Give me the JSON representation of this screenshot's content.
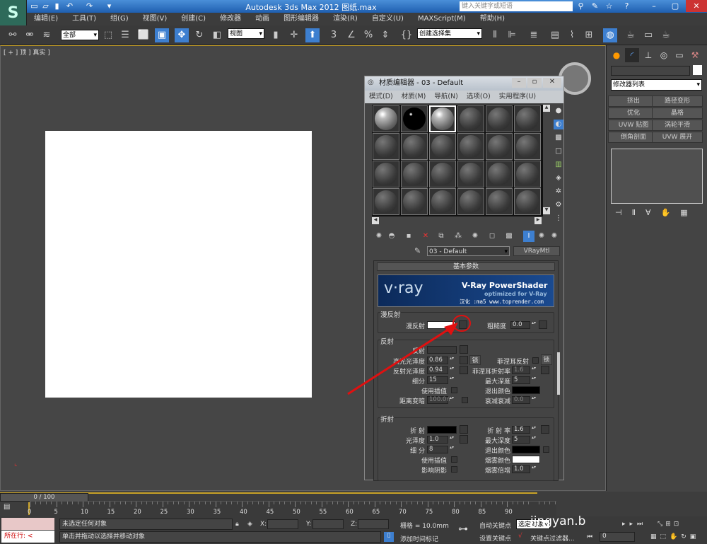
{
  "app": {
    "title": "Autodesk 3ds Max  2012    图纸.max",
    "search_placeholder": "键入关键字或短语",
    "logo": "S"
  },
  "menu": [
    "编辑(E)",
    "工具(T)",
    "组(G)",
    "视图(V)",
    "创建(C)",
    "修改器",
    "动画",
    "图形编辑器",
    "渲染(R)",
    "自定义(U)",
    "MAXScript(M)",
    "帮助(H)"
  ],
  "toolbar": {
    "selection_filter": "全部",
    "coord_system": "视图",
    "named_selection": "创建选择集",
    "snap_labels": [
      "3",
      "%"
    ]
  },
  "viewport": {
    "label": "[ + ] 顶 ] 真实 ]"
  },
  "command_panel": {
    "modifier_list": "修改器列表",
    "buttons": [
      "挤出",
      "路径变形",
      "优化",
      "晶格",
      "UVW 贴图",
      "涡轮平滑",
      "倒角剖面",
      "UVW 展开"
    ]
  },
  "material_editor": {
    "title": "材质编辑器 - 03 - Default",
    "menu": [
      "模式(D)",
      "材质(M)",
      "导航(N)",
      "选项(O)",
      "实用程序(U)"
    ],
    "material_name": "03 - Default",
    "material_type": "VRayMtl",
    "rollout": "基本参数",
    "banner": {
      "logo": "v·ray",
      "heading": "V-Ray PowerShader",
      "sub": "optimized for V-Ray",
      "credit": "汉化 :ma5 www.toprender.com"
    },
    "diffuse": {
      "group": "漫反射",
      "diffuse_label": "漫反射",
      "diffuse_color": "#ffffff",
      "roughness_label": "粗糙度",
      "roughness": "0.0"
    },
    "reflection": {
      "group": "反射",
      "reflect_label": "反射",
      "hilight_label": "高光光泽度",
      "hilight": "0.86",
      "lock": "锁",
      "fresnel_label": "菲涅耳反射",
      "fresnel_lock": "锁",
      "refl_gloss_label": "反射光泽度",
      "refl_gloss": "0.94",
      "fresnel_ior_label": "菲涅耳折射率",
      "fresnel_ior": "1.6",
      "subdivs_label": "细分",
      "subdivs": "15",
      "max_depth_label": "最大深度",
      "max_depth": "5",
      "interp_label": "使用插值",
      "exit_color_label": "退出颜色",
      "dim_label": "距离变暗",
      "dim": "100.0n",
      "falloff_label": "衰减衰减",
      "falloff": "0.0"
    },
    "refraction": {
      "group": "折射",
      "refract_label": "折 射",
      "ior_label": "折 射 率",
      "ior": "1.6",
      "gloss_label": "光泽度",
      "gloss": "1.0",
      "max_depth_label": "最大深度",
      "max_depth": "5",
      "subdivs_label": "细 分",
      "subdivs": "8",
      "exit_color_label": "退出颜色",
      "interp_label": "使用插值",
      "fog_color_label": "烟雾颜色",
      "shadows_label": "影响阴影",
      "fog_mult_label": "烟雾倍增",
      "fog_mult": "1.0"
    }
  },
  "timeline": {
    "frame": "0 / 100",
    "ticks": [
      "0",
      "5",
      "10",
      "15",
      "20",
      "25",
      "30",
      "35",
      "40",
      "45",
      "50",
      "55",
      "60",
      "65",
      "70",
      "75",
      "80",
      "85",
      "90"
    ]
  },
  "status": {
    "selection": "未选定任何对象",
    "prompt": "单击并拖动以选择并移动对象",
    "script": "所在行: <",
    "x_label": "X:",
    "y_label": "Y:",
    "z_label": "Z:",
    "grid": "栅格 = 10.0mm",
    "add_tag": "添加时间标记",
    "auto_key": "自动关键点",
    "set_key": "设置关键点",
    "key_mode": "选定对象",
    "key_filter": "关键点过滤器...",
    "frame": "0",
    "watermark": "jingyan.b"
  },
  "colors": {
    "accent": "#3d7fd0",
    "annotation": "#e01010"
  }
}
